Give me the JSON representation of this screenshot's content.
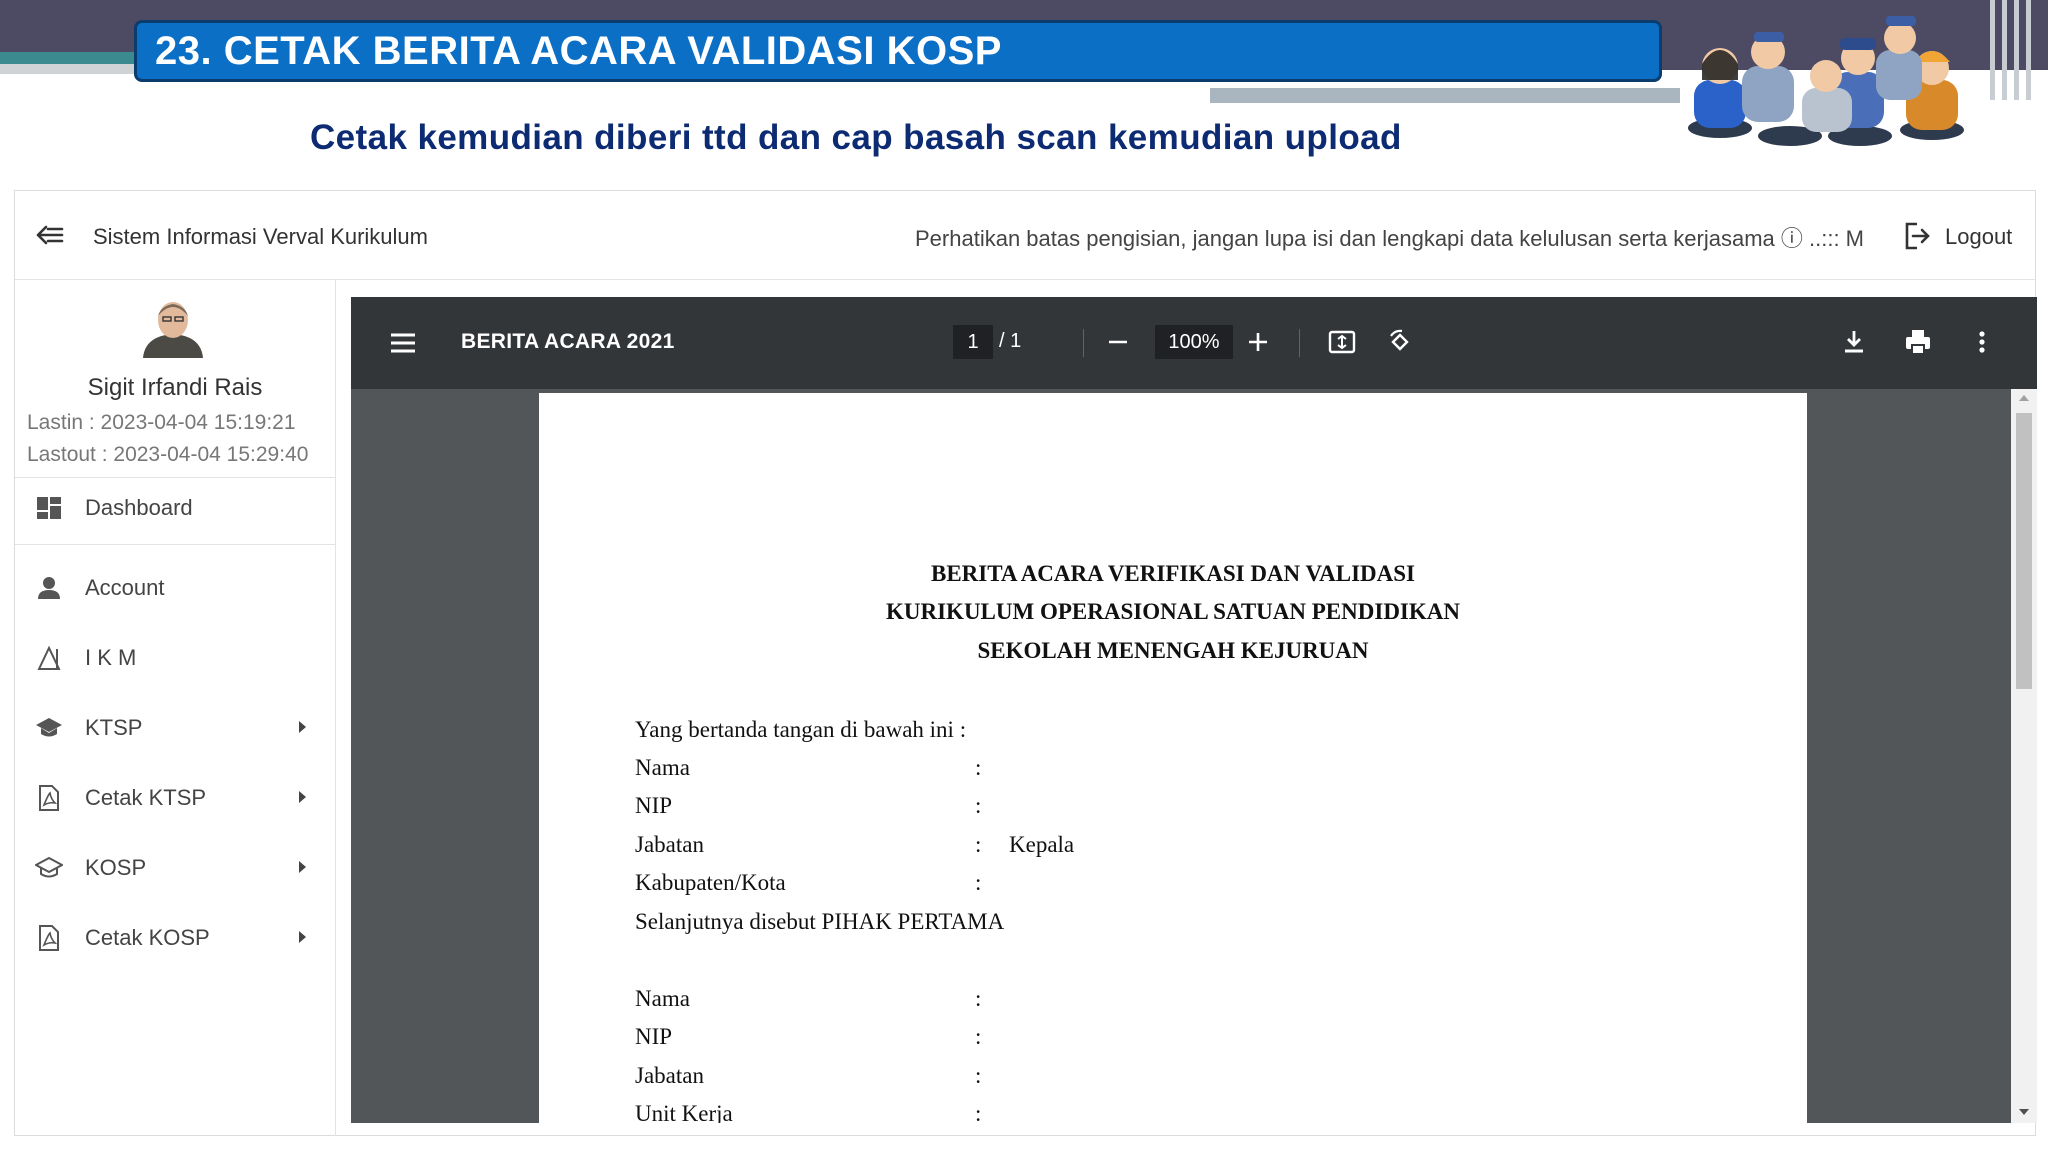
{
  "slide": {
    "title": "23. CETAK BERITA ACARA VALIDASI KOSP",
    "subtitle": "Cetak kemudian diberi ttd dan cap basah scan kemudian upload"
  },
  "appbar": {
    "title": "Sistem Informasi Verval Kurikulum",
    "notice": "Perhatikan batas pengisian, jangan lupa isi dan lengkapi data kelulusan serta kerjasama ⓘ ..::: M",
    "logout_label": "Logout"
  },
  "user": {
    "name": "Sigit Irfandi Rais",
    "lastin": "Lastin : 2023-04-04 15:19:21",
    "lastout": "Lastout : 2023-04-04 15:29:40"
  },
  "sidebar": {
    "items": [
      {
        "label": "Dashboard",
        "icon": "dashboard-icon",
        "submenu": false
      },
      {
        "label": "Account",
        "icon": "person-icon",
        "submenu": false
      },
      {
        "label": "I K M",
        "icon": "ruler-icon",
        "submenu": false
      },
      {
        "label": "KTSP",
        "icon": "school-icon",
        "submenu": true
      },
      {
        "label": "Cetak KTSP",
        "icon": "pdf-icon",
        "submenu": true
      },
      {
        "label": "KOSP",
        "icon": "school-outline-icon",
        "submenu": true
      },
      {
        "label": "Cetak KOSP",
        "icon": "pdf-icon",
        "submenu": true
      }
    ]
  },
  "viewer": {
    "doc_title": "BERITA ACARA 2021",
    "page_current": "1",
    "page_total": "/  1",
    "zoom": "100%"
  },
  "document": {
    "heading": [
      "BERITA ACARA VERIFIKASI DAN VALIDASI",
      "KURIKULUM OPERASIONAL SATUAN PENDIDIKAN",
      "SEKOLAH MENENGAH KEJURUAN"
    ],
    "intro": "Yang bertanda tangan di bawah ini :",
    "first_party": [
      {
        "label": "Nama",
        "value": ""
      },
      {
        "label": "NIP",
        "value": ""
      },
      {
        "label": "Jabatan",
        "value": "Kepala"
      },
      {
        "label": "Kabupaten/Kota",
        "value": ""
      }
    ],
    "first_party_note": "Selanjutnya disebut PIHAK PERTAMA",
    "second_party": [
      {
        "label": "Nama",
        "value": ""
      },
      {
        "label": "NIP",
        "value": ""
      },
      {
        "label": "Jabatan",
        "value": ""
      },
      {
        "label": "Unit Kerja",
        "value": ""
      }
    ],
    "colon": ":"
  }
}
